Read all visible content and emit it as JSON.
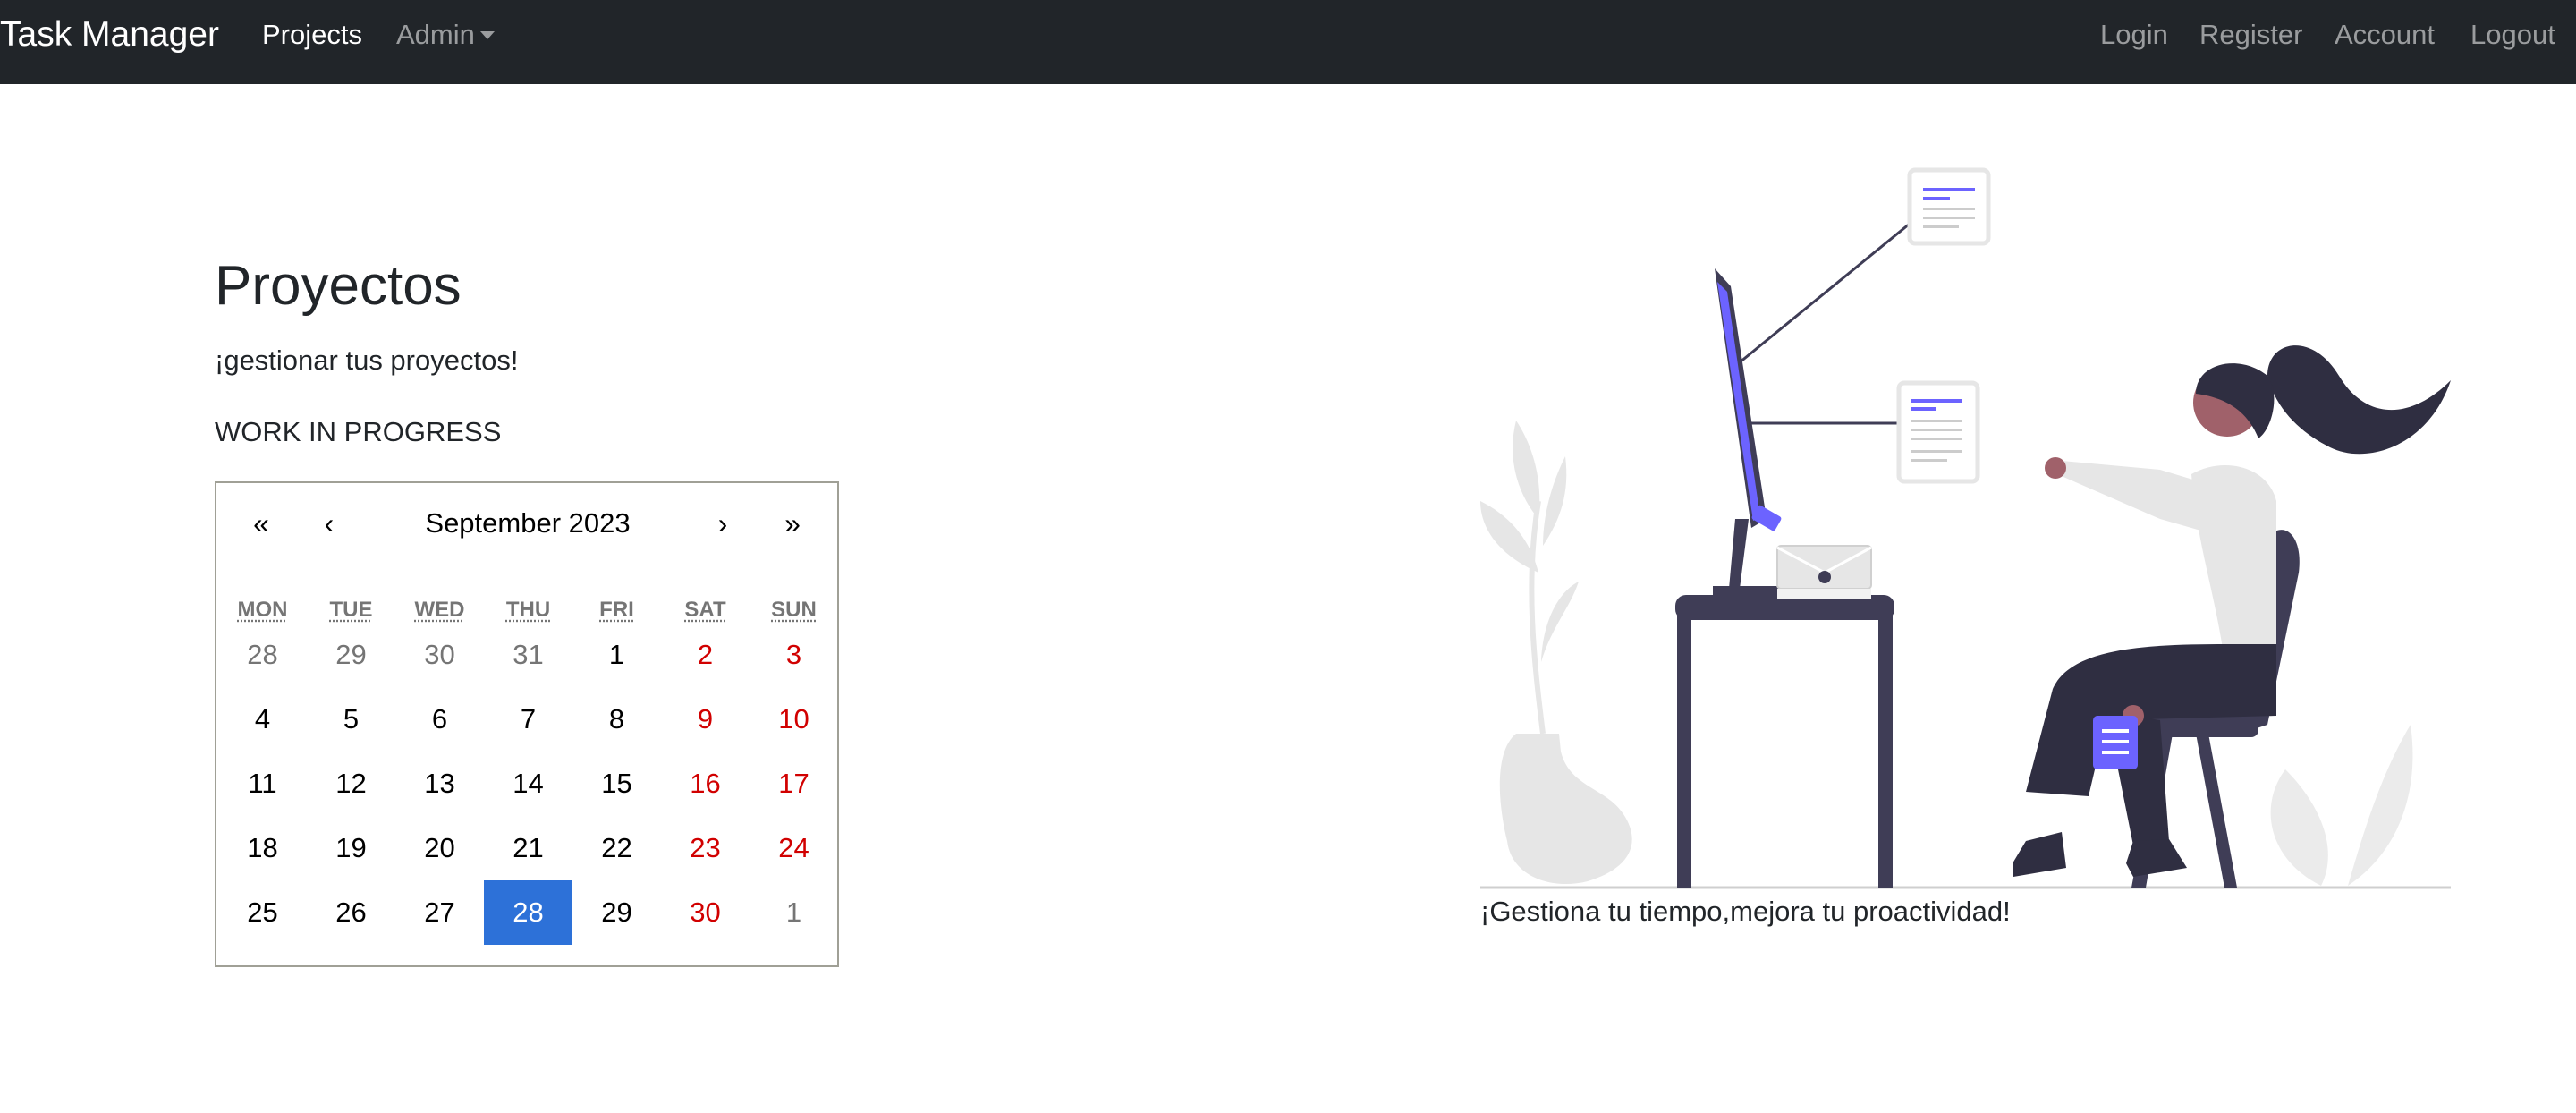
{
  "navbar": {
    "brand": "Task Manager",
    "left_links": [
      {
        "label": "Projects",
        "active": true
      },
      {
        "label": "Admin",
        "dropdown": true
      }
    ],
    "right_links": [
      {
        "label": "Login"
      },
      {
        "label": "Register"
      },
      {
        "label": "Account"
      },
      {
        "label": "Logout"
      }
    ]
  },
  "main": {
    "title": "Proyectos",
    "subtitle": "¡gestionar tus proyectos!",
    "status": "WORK IN PROGRESS"
  },
  "calendar": {
    "nav": {
      "prev2": "«",
      "prev": "‹",
      "label": "September 2023",
      "next": "›",
      "next2": "»"
    },
    "weekdays": [
      "MON",
      "TUE",
      "WED",
      "THU",
      "FRI",
      "SAT",
      "SUN"
    ],
    "weeks": [
      [
        "28",
        "29",
        "30",
        "31",
        "1",
        "2",
        "3"
      ],
      [
        "4",
        "5",
        "6",
        "7",
        "8",
        "9",
        "10"
      ],
      [
        "11",
        "12",
        "13",
        "14",
        "15",
        "16",
        "17"
      ],
      [
        "18",
        "19",
        "20",
        "21",
        "22",
        "23",
        "24"
      ],
      [
        "25",
        "26",
        "27",
        "28",
        "29",
        "30",
        "1"
      ]
    ],
    "selected_week": 4,
    "selected_weekday": 3,
    "colors": {
      "weekend": "#d10000",
      "neighbor": "#757575",
      "selected_bg": "#2d71d8"
    }
  },
  "illustration": {
    "caption": "¡Gestiona tu tiempo,mejora tu proactividad!",
    "accent_color": "#6c63ff",
    "dark_color": "#3f3d56"
  }
}
